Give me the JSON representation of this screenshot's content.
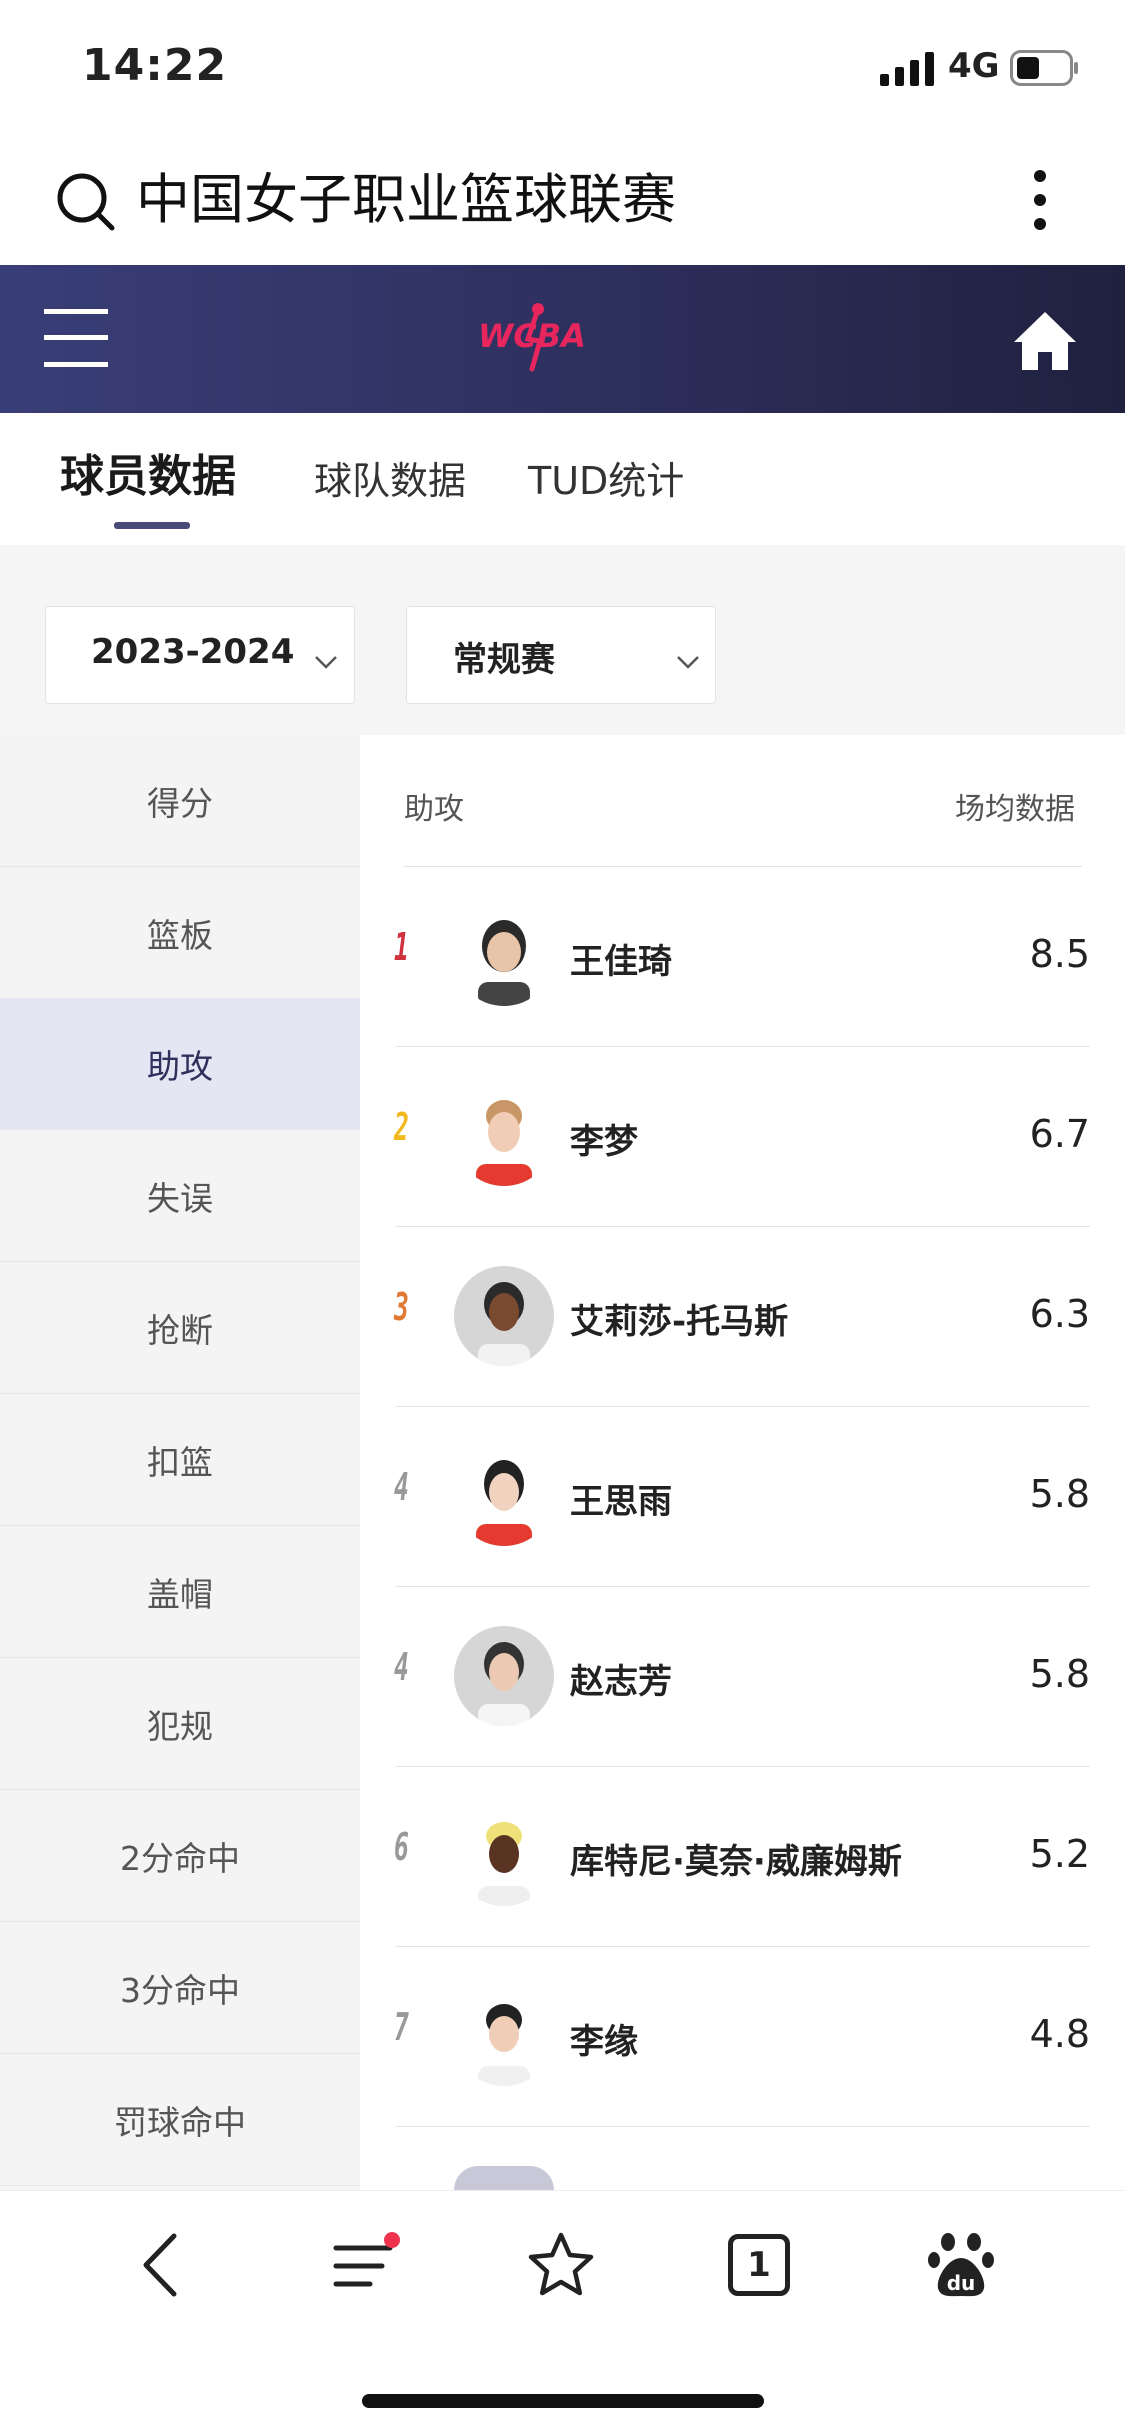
{
  "status": {
    "time": "14:22",
    "network": "4G"
  },
  "search": {
    "query": "中国女子职业篮球联赛"
  },
  "banner": {
    "logo_text": "WCBA",
    "accent": "#e8265e"
  },
  "tabs": [
    {
      "label": "球员数据",
      "active": true
    },
    {
      "label": "球队数据",
      "active": false
    },
    {
      "label": "TUD统计",
      "active": false
    }
  ],
  "filters": {
    "season": "2023-2024",
    "stage": "常规赛"
  },
  "sidebar": {
    "items": [
      "得分",
      "篮板",
      "助攻",
      "失误",
      "抢断",
      "扣篮",
      "盖帽",
      "犯规",
      "2分命中",
      "3分命中",
      "罚球命中"
    ],
    "active": "助攻"
  },
  "list": {
    "header_left": "助攻",
    "header_right": "场均数据",
    "rows": [
      {
        "rank": "1",
        "name": "王佳琦",
        "value": "8.5",
        "rank_color": "#d0313f"
      },
      {
        "rank": "2",
        "name": "李梦",
        "value": "6.7",
        "rank_color": "#f2b81e"
      },
      {
        "rank": "3",
        "name": "艾莉莎-托马斯",
        "value": "6.3",
        "rank_color": "#e07a33"
      },
      {
        "rank": "4",
        "name": "王思雨",
        "value": "5.8",
        "rank_color": "#999999"
      },
      {
        "rank": "4",
        "name": "赵志芳",
        "value": "5.8",
        "rank_color": "#999999"
      },
      {
        "rank": "6",
        "name": "库特尼·莫奈·威廉姆斯",
        "value": "5.2",
        "rank_color": "#999999"
      },
      {
        "rank": "7",
        "name": "李缘",
        "value": "4.8",
        "rank_color": "#999999"
      }
    ]
  },
  "bottom_bar": {
    "tab_count": "1",
    "baidu_label": "du"
  }
}
